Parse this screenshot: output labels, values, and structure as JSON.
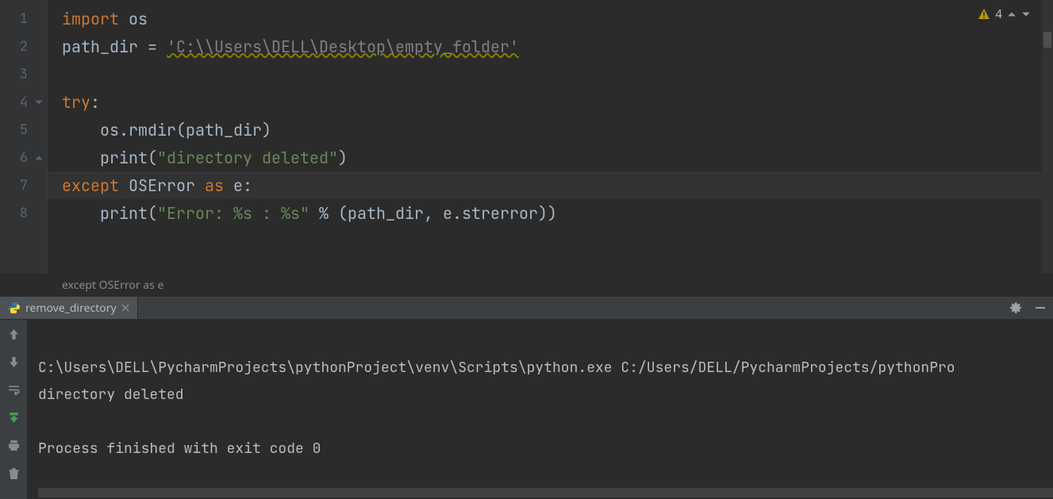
{
  "editor": {
    "lines": [
      "1",
      "2",
      "3",
      "4",
      "5",
      "6",
      "7",
      "8"
    ],
    "active_line_index": 6,
    "code": {
      "l1": {
        "kw": "import",
        "mod": "os"
      },
      "l2": {
        "lhs": "path_dir = ",
        "str": "'C:\\\\Users\\DELL\\Desktop\\empty_folder'"
      },
      "l4": {
        "kw": "try",
        "colon": ":"
      },
      "l5": {
        "indent": "    ",
        "call": "os.rmdir(path_dir)"
      },
      "l6": {
        "indent": "    ",
        "fn": "print",
        "open": "(",
        "str": "\"directory deleted\"",
        "close": ")"
      },
      "l7": {
        "kw1": "except",
        "exc": "OSError",
        "kw2": "as",
        "alias": "e",
        "colon": ":"
      },
      "l8": {
        "indent": "    ",
        "fn": "print",
        "open": "(",
        "str": "\"Error: %s : %s\"",
        "pct": " % ",
        "args": "(path_dir, e.strerror)",
        "close": ")"
      }
    }
  },
  "inspections": {
    "count": "4"
  },
  "breadcrumb": "except OSError as e",
  "run": {
    "tab_label": "remove_directory",
    "console": {
      "line1": "C:\\Users\\DELL\\PycharmProjects\\pythonProject\\venv\\Scripts\\python.exe C:/Users/DELL/PycharmProjects/pythonPro",
      "line2": "directory deleted",
      "line3": "",
      "line4": "Process finished with exit code 0"
    }
  }
}
